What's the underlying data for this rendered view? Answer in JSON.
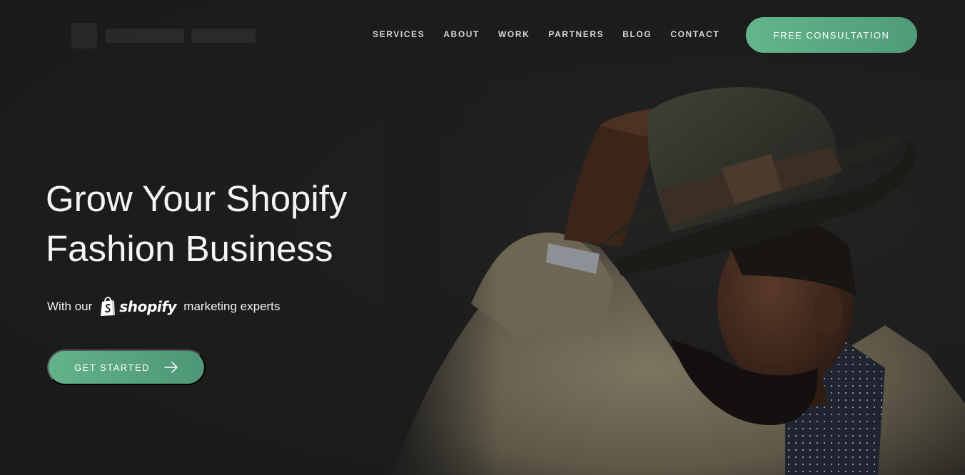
{
  "header": {
    "nav": [
      {
        "label": "SERVICES"
      },
      {
        "label": "ABOUT"
      },
      {
        "label": "WORK"
      },
      {
        "label": "PARTNERS"
      },
      {
        "label": "BLOG"
      },
      {
        "label": "CONTACT"
      }
    ],
    "cta_label": "FREE CONSULTATION"
  },
  "hero": {
    "title_line1": "Grow Your Shopify",
    "title_line2": "Fashion Business",
    "sub_prefix": "With our",
    "brand": "shopify",
    "sub_suffix": "marketing experts",
    "button_label": "GET STARTED",
    "button_icon": "arrow-right-icon"
  },
  "colors": {
    "background": "#1c1c1c",
    "accent_start": "#64b58b",
    "accent_end": "#4f9b79",
    "nav_text": "#d6d6d6"
  }
}
